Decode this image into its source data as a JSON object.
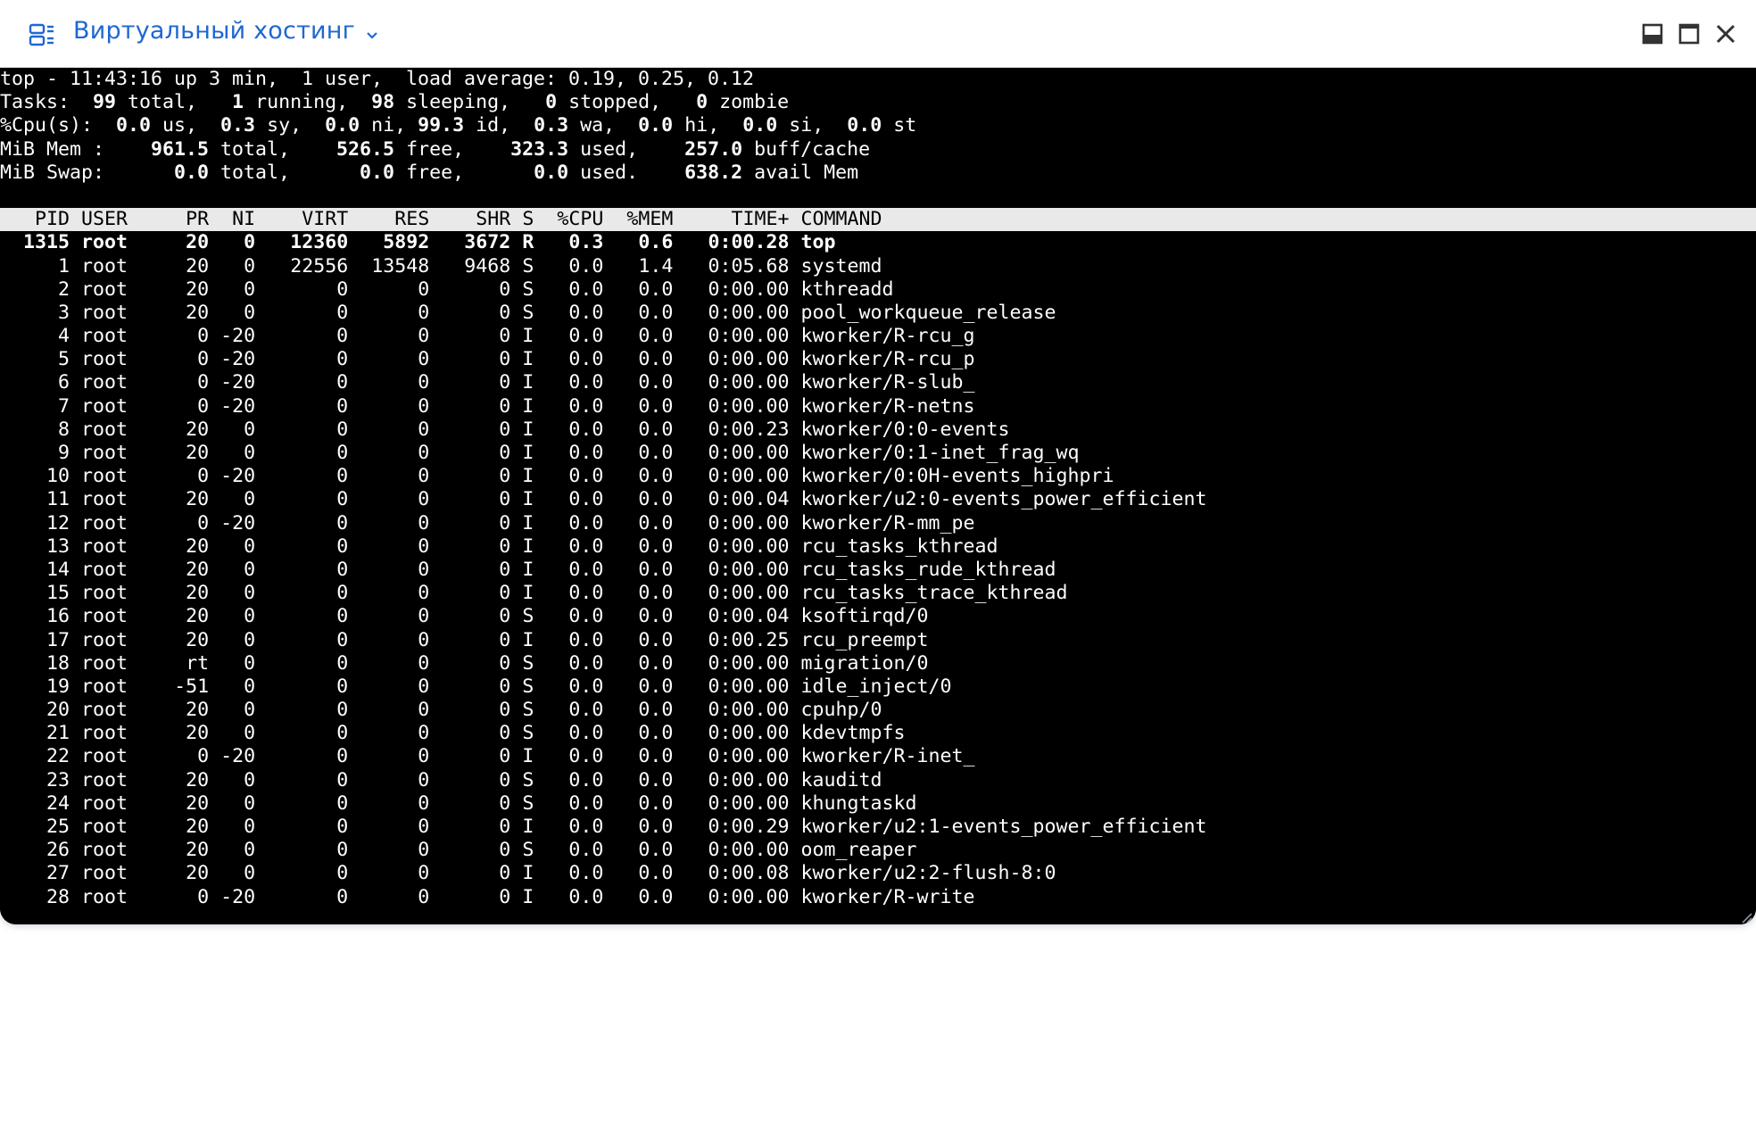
{
  "window": {
    "title": "Виртуальный хостинг",
    "controls": [
      "minimize-icon",
      "maximize-icon",
      "close-icon"
    ],
    "accent_color": "#1f67d2"
  },
  "summary": [
    [
      "top - 11:43:16 up 3 min,  1 user,  load average: 0.19, 0.25, 0.12"
    ],
    [
      "Tasks: ",
      {
        "b": " 99"
      },
      " total,   ",
      {
        "b": "1"
      },
      " running,  ",
      {
        "b": "98"
      },
      " sleeping,   ",
      {
        "b": "0"
      },
      " stopped,   ",
      {
        "b": "0"
      },
      " zombie"
    ],
    [
      "%Cpu(s):  ",
      {
        "b": "0.0"
      },
      " us,  ",
      {
        "b": "0.3"
      },
      " sy,  ",
      {
        "b": "0.0"
      },
      " ni, ",
      {
        "b": "99.3"
      },
      " id,  ",
      {
        "b": "0.3"
      },
      " wa,  ",
      {
        "b": "0.0"
      },
      " hi,  ",
      {
        "b": "0.0"
      },
      " si,  ",
      {
        "b": "0.0"
      },
      " st"
    ],
    [
      "MiB Mem :    ",
      {
        "b": "961.5"
      },
      " total,    ",
      {
        "b": "526.5"
      },
      " free,    ",
      {
        "b": "323.3"
      },
      " used,    ",
      {
        "b": "257.0"
      },
      " buff/cache"
    ],
    [
      "MiB Swap:      ",
      {
        "b": "0.0"
      },
      " total,      ",
      {
        "b": "0.0"
      },
      " free,      ",
      {
        "b": "0.0"
      },
      " used.    ",
      {
        "b": "638.2"
      },
      " avail Mem"
    ]
  ],
  "process_table": {
    "columns": [
      "PID",
      "USER",
      "PR",
      "NI",
      "VIRT",
      "RES",
      "SHR",
      "S",
      "%CPU",
      "%MEM",
      "TIME+",
      "COMMAND"
    ],
    "rows": [
      [
        "1315",
        "root",
        "20",
        "0",
        "12360",
        "5892",
        "3672",
        "R",
        "0.3",
        "0.6",
        "0:00.28",
        "top"
      ],
      [
        "1",
        "root",
        "20",
        "0",
        "22556",
        "13548",
        "9468",
        "S",
        "0.0",
        "1.4",
        "0:05.68",
        "systemd"
      ],
      [
        "2",
        "root",
        "20",
        "0",
        "0",
        "0",
        "0",
        "S",
        "0.0",
        "0.0",
        "0:00.00",
        "kthreadd"
      ],
      [
        "3",
        "root",
        "20",
        "0",
        "0",
        "0",
        "0",
        "S",
        "0.0",
        "0.0",
        "0:00.00",
        "pool_workqueue_release"
      ],
      [
        "4",
        "root",
        "0",
        "-20",
        "0",
        "0",
        "0",
        "I",
        "0.0",
        "0.0",
        "0:00.00",
        "kworker/R-rcu_g"
      ],
      [
        "5",
        "root",
        "0",
        "-20",
        "0",
        "0",
        "0",
        "I",
        "0.0",
        "0.0",
        "0:00.00",
        "kworker/R-rcu_p"
      ],
      [
        "6",
        "root",
        "0",
        "-20",
        "0",
        "0",
        "0",
        "I",
        "0.0",
        "0.0",
        "0:00.00",
        "kworker/R-slub_"
      ],
      [
        "7",
        "root",
        "0",
        "-20",
        "0",
        "0",
        "0",
        "I",
        "0.0",
        "0.0",
        "0:00.00",
        "kworker/R-netns"
      ],
      [
        "8",
        "root",
        "20",
        "0",
        "0",
        "0",
        "0",
        "I",
        "0.0",
        "0.0",
        "0:00.23",
        "kworker/0:0-events"
      ],
      [
        "9",
        "root",
        "20",
        "0",
        "0",
        "0",
        "0",
        "I",
        "0.0",
        "0.0",
        "0:00.00",
        "kworker/0:1-inet_frag_wq"
      ],
      [
        "10",
        "root",
        "0",
        "-20",
        "0",
        "0",
        "0",
        "I",
        "0.0",
        "0.0",
        "0:00.00",
        "kworker/0:0H-events_highpri"
      ],
      [
        "11",
        "root",
        "20",
        "0",
        "0",
        "0",
        "0",
        "I",
        "0.0",
        "0.0",
        "0:00.04",
        "kworker/u2:0-events_power_efficient"
      ],
      [
        "12",
        "root",
        "0",
        "-20",
        "0",
        "0",
        "0",
        "I",
        "0.0",
        "0.0",
        "0:00.00",
        "kworker/R-mm_pe"
      ],
      [
        "13",
        "root",
        "20",
        "0",
        "0",
        "0",
        "0",
        "I",
        "0.0",
        "0.0",
        "0:00.00",
        "rcu_tasks_kthread"
      ],
      [
        "14",
        "root",
        "20",
        "0",
        "0",
        "0",
        "0",
        "I",
        "0.0",
        "0.0",
        "0:00.00",
        "rcu_tasks_rude_kthread"
      ],
      [
        "15",
        "root",
        "20",
        "0",
        "0",
        "0",
        "0",
        "I",
        "0.0",
        "0.0",
        "0:00.00",
        "rcu_tasks_trace_kthread"
      ],
      [
        "16",
        "root",
        "20",
        "0",
        "0",
        "0",
        "0",
        "S",
        "0.0",
        "0.0",
        "0:00.04",
        "ksoftirqd/0"
      ],
      [
        "17",
        "root",
        "20",
        "0",
        "0",
        "0",
        "0",
        "I",
        "0.0",
        "0.0",
        "0:00.25",
        "rcu_preempt"
      ],
      [
        "18",
        "root",
        "rt",
        "0",
        "0",
        "0",
        "0",
        "S",
        "0.0",
        "0.0",
        "0:00.00",
        "migration/0"
      ],
      [
        "19",
        "root",
        "-51",
        "0",
        "0",
        "0",
        "0",
        "S",
        "0.0",
        "0.0",
        "0:00.00",
        "idle_inject/0"
      ],
      [
        "20",
        "root",
        "20",
        "0",
        "0",
        "0",
        "0",
        "S",
        "0.0",
        "0.0",
        "0:00.00",
        "cpuhp/0"
      ],
      [
        "21",
        "root",
        "20",
        "0",
        "0",
        "0",
        "0",
        "S",
        "0.0",
        "0.0",
        "0:00.00",
        "kdevtmpfs"
      ],
      [
        "22",
        "root",
        "0",
        "-20",
        "0",
        "0",
        "0",
        "I",
        "0.0",
        "0.0",
        "0:00.00",
        "kworker/R-inet_"
      ],
      [
        "23",
        "root",
        "20",
        "0",
        "0",
        "0",
        "0",
        "S",
        "0.0",
        "0.0",
        "0:00.00",
        "kauditd"
      ],
      [
        "24",
        "root",
        "20",
        "0",
        "0",
        "0",
        "0",
        "S",
        "0.0",
        "0.0",
        "0:00.00",
        "khungtaskd"
      ],
      [
        "25",
        "root",
        "20",
        "0",
        "0",
        "0",
        "0",
        "I",
        "0.0",
        "0.0",
        "0:00.29",
        "kworker/u2:1-events_power_efficient"
      ],
      [
        "26",
        "root",
        "20",
        "0",
        "0",
        "0",
        "0",
        "S",
        "0.0",
        "0.0",
        "0:00.00",
        "oom_reaper"
      ],
      [
        "27",
        "root",
        "20",
        "0",
        "0",
        "0",
        "0",
        "I",
        "0.0",
        "0.0",
        "0:00.08",
        "kworker/u2:2-flush-8:0"
      ],
      [
        "28",
        "root",
        "0",
        "-20",
        "0",
        "0",
        "0",
        "I",
        "0.0",
        "0.0",
        "0:00.00",
        "kworker/R-write"
      ]
    ],
    "highlighted_row": 0
  }
}
